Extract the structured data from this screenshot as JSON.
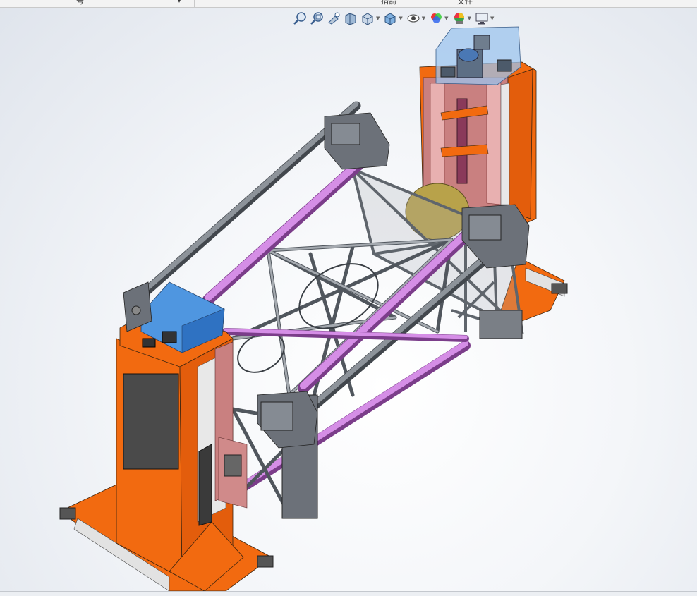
{
  "app": {
    "tab_partial_left": "号",
    "tab_partial_mid": "措箭",
    "tab_partial_right": "文件"
  },
  "view_toolbar": {
    "items": [
      {
        "name": "zoom-to-fit-icon"
      },
      {
        "name": "zoom-to-area-icon"
      },
      {
        "name": "previous-view-icon"
      },
      {
        "name": "section-view-icon"
      },
      {
        "name": "view-orientation-icon"
      },
      {
        "name": "display-style-icon"
      },
      {
        "name": "hide-show-items-icon"
      },
      {
        "name": "edit-appearance-icon"
      },
      {
        "name": "apply-scene-icon"
      },
      {
        "name": "view-settings-icon"
      }
    ]
  },
  "colors": {
    "frame_orange": "#f26a10",
    "rail_purple": "#d58ee6",
    "truss_gray": "#9aa0a7",
    "housing_blue": "#4f96e0",
    "panel_dark": "#4a4a4a",
    "gear_olive": "#b8a24a"
  }
}
